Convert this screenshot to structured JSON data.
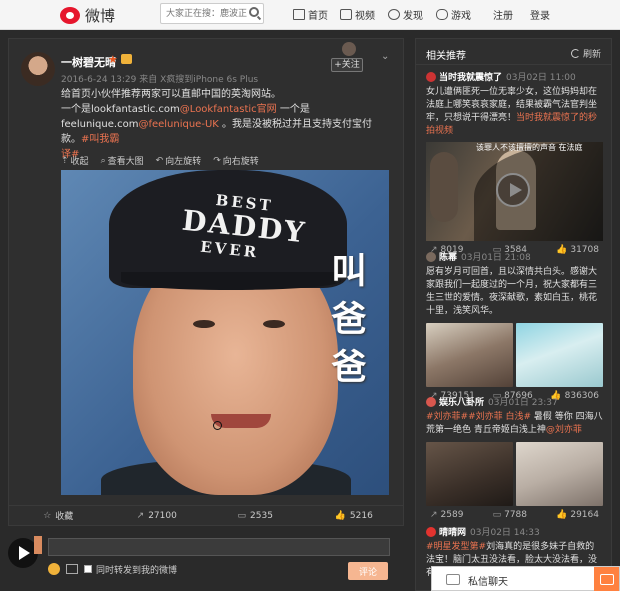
{
  "topbar": {
    "logo_text": "微博",
    "search_placeholder": "大家正在搜：鹿波正...",
    "nav": [
      {
        "label": "首页",
        "icon": "home-icon"
      },
      {
        "label": "视频",
        "icon": "video-icon"
      },
      {
        "label": "发现",
        "icon": "discover-icon"
      },
      {
        "label": "游戏",
        "icon": "game-icon"
      }
    ],
    "register": "注册",
    "login": "登录"
  },
  "post": {
    "username": "一树碧无晴",
    "meta": "2016-6-24 13:29 来自 X疯搜到iPhone 6s Plus",
    "follow": "+关注",
    "text_line1": "给首页小伙伴推荐两家可以直邮中国的英淘网站。",
    "text_line2a": "一个是lookfantastic.com",
    "text_line2b": "@Lookfantastic官网",
    "text_line2c": " 一个是",
    "text_line3a": "feelunique.com",
    "text_line3b": "@feelunique-UK",
    "text_line3c": " 。我是没被税过并且支持支付宝付款。",
    "text_line3d": "#叫我霸",
    "text_line4": "译#",
    "actions": [
      {
        "label": "收起",
        "icon": "collapse-icon"
      },
      {
        "label": "查看大图",
        "icon": "enlarge-icon"
      },
      {
        "label": "向左旋转",
        "icon": "rotate-left-icon"
      },
      {
        "label": "向右旋转",
        "icon": "rotate-right-icon"
      }
    ],
    "photo": {
      "cap_line1": "BEST",
      "cap_line2": "DADDY",
      "cap_line3": "EVER",
      "overlay": "叫爸爸"
    },
    "footer": {
      "favorite": "收藏",
      "repost": "27100",
      "comment": "2535",
      "like": "5216"
    }
  },
  "comment": {
    "placeholder": "",
    "repost_label": "同时转发到我的微博",
    "submit": "评论"
  },
  "panel": {
    "title": "相关推荐",
    "refresh": "刷新",
    "items": [
      {
        "name": "当时我就震惊了",
        "time": "03月02日 11:00",
        "text": "女儿遭俩匪死一位无辜少女，这位妈妈却在法庭上哪笑哀哀家庭，结果被霸气法官判坐牢，只想说干得漂亮！",
        "link": "当时我就震惊了的秒拍视频",
        "video_caption": "该罪人不该擅擅的声音 在法庭",
        "reposts": "8019",
        "comments": "3584",
        "likes": "31708"
      },
      {
        "name": "陈幂",
        "time": "03月01日 21:08",
        "text": "愿有岁月可回首，且以深情共白头。感谢大家跟我们一起度过的一个月，祝大家都有三生三世的爱情。夜深献歌，素如白玉，桃花十里，浅笑风华。",
        "reposts": "739151",
        "comments": "87696",
        "likes": "836306"
      },
      {
        "name": "娱乐八卦所",
        "time": "03月01日 23:37",
        "text_link": "#刘亦菲##刘亦菲 白浅#",
        "text": " 暑假 等你 四海八荒第一绝色 青丘帝姬白浅上神",
        "text_at": "@刘亦菲",
        "reposts": "2589",
        "comments": "7788",
        "likes": "29164"
      },
      {
        "name": "晴晴网",
        "time": "03月02日 14:33",
        "text_link": "#明星发型第#",
        "text": "刘海真的是很多妹子自救的法宝！脑门太丑没法看，脸太大没法看，没有刷毛没法"
      }
    ]
  },
  "chat": {
    "label": "私信聊天"
  }
}
